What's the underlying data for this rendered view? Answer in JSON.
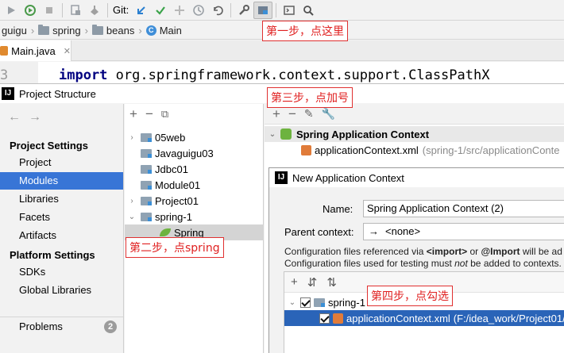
{
  "toolbar": {
    "git_label": "Git:"
  },
  "breadcrumb": {
    "items": [
      "guigu",
      "spring",
      "beans",
      "Main"
    ]
  },
  "editor": {
    "tab_label": "Main.java",
    "line_number": "3",
    "code_keyword": "import",
    "code_rest": " org.springframework.context.support.ClassPathX"
  },
  "project_structure": {
    "title": "Project Structure",
    "icon_letter": "IJ",
    "section_project_settings": "Project Settings",
    "project_items": [
      "Project",
      "Modules",
      "Libraries",
      "Facets",
      "Artifacts"
    ],
    "section_platform_settings": "Platform Settings",
    "platform_items": [
      "SDKs",
      "Global Libraries"
    ],
    "problems_label": "Problems",
    "problems_count": "2",
    "modules": [
      "05web",
      "Javaguigu03",
      "Jdbc01",
      "Module01",
      "Project01",
      "spring-1"
    ],
    "facet": "Spring",
    "context_header": "Spring Application Context",
    "context_file": "applicationContext.xml",
    "context_file_path": "(spring-1/src/applicationConte"
  },
  "new_context_dialog": {
    "title": "New Application Context",
    "name_label": "Name:",
    "name_value": "Spring Application Context (2)",
    "parent_label": "Parent context:",
    "parent_value": "<none>",
    "info_line1_pre": "Configuration files referenced via ",
    "info_line1_b1": "<import>",
    "info_line1_mid": " or ",
    "info_line1_b2": "@Import",
    "info_line1_post": " will be ad",
    "info_line2_pre": "Configuration files used for testing must ",
    "info_line2_em": "not",
    "info_line2_post": " be added to contexts.",
    "tree_module": "spring-1",
    "tree_file": "applicationContext.xml",
    "tree_file_path": "(F:/idea_work/Project01/s"
  },
  "annotations": {
    "step1": "第一步，点这里",
    "step2": "第二步，点spring",
    "step3": "第三步，点加号",
    "step4": "第四步，点勾选"
  },
  "colors": {
    "selection_blue": "#3875d6",
    "annotation_red": "#e02020",
    "spring_green": "#6db33f"
  }
}
